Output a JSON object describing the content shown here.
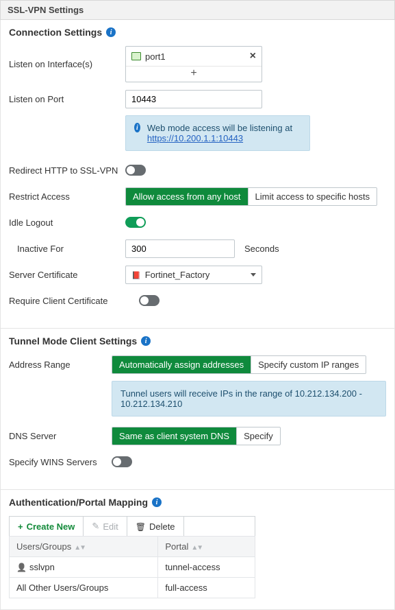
{
  "page_title": "SSL-VPN Settings",
  "connection": {
    "heading": "Connection Settings",
    "listen_iface_label": "Listen on Interface(s)",
    "iface_value": "port1",
    "listen_port_label": "Listen on Port",
    "listen_port_value": "10443",
    "web_mode_text": "Web mode access will be listening at ",
    "web_mode_url": "https://10.200.1.1:10443",
    "redirect_label": "Redirect HTTP to SSL-VPN",
    "restrict_label": "Restrict Access",
    "restrict_opt_allow": "Allow access from any host",
    "restrict_opt_limit": "Limit access to specific hosts",
    "idle_logout_label": "Idle Logout",
    "inactive_for_label": "Inactive For",
    "inactive_value": "300",
    "inactive_unit": "Seconds",
    "server_cert_label": "Server Certificate",
    "server_cert_value": "Fortinet_Factory",
    "require_client_cert_label": "Require Client Certificate"
  },
  "tunnel": {
    "heading": "Tunnel Mode Client Settings",
    "addr_range_label": "Address Range",
    "addr_opt_auto": "Automatically assign addresses",
    "addr_opt_custom": "Specify custom IP ranges",
    "tunnel_info": "Tunnel users will receive IPs in the range of 10.212.134.200 - 10.212.134.210",
    "dns_label": "DNS Server",
    "dns_opt_same": "Same as client system DNS",
    "dns_opt_specify": "Specify",
    "wins_label": "Specify WINS Servers"
  },
  "auth": {
    "heading": "Authentication/Portal Mapping",
    "create_label": "Create New",
    "edit_label": "Edit",
    "delete_label": "Delete",
    "col_users": "Users/Groups",
    "col_portal": "Portal",
    "rows": [
      {
        "user": "sslvpn",
        "portal": "tunnel-access",
        "has_icon": true
      },
      {
        "user": "All Other Users/Groups",
        "portal": "full-access",
        "has_icon": false
      }
    ]
  }
}
